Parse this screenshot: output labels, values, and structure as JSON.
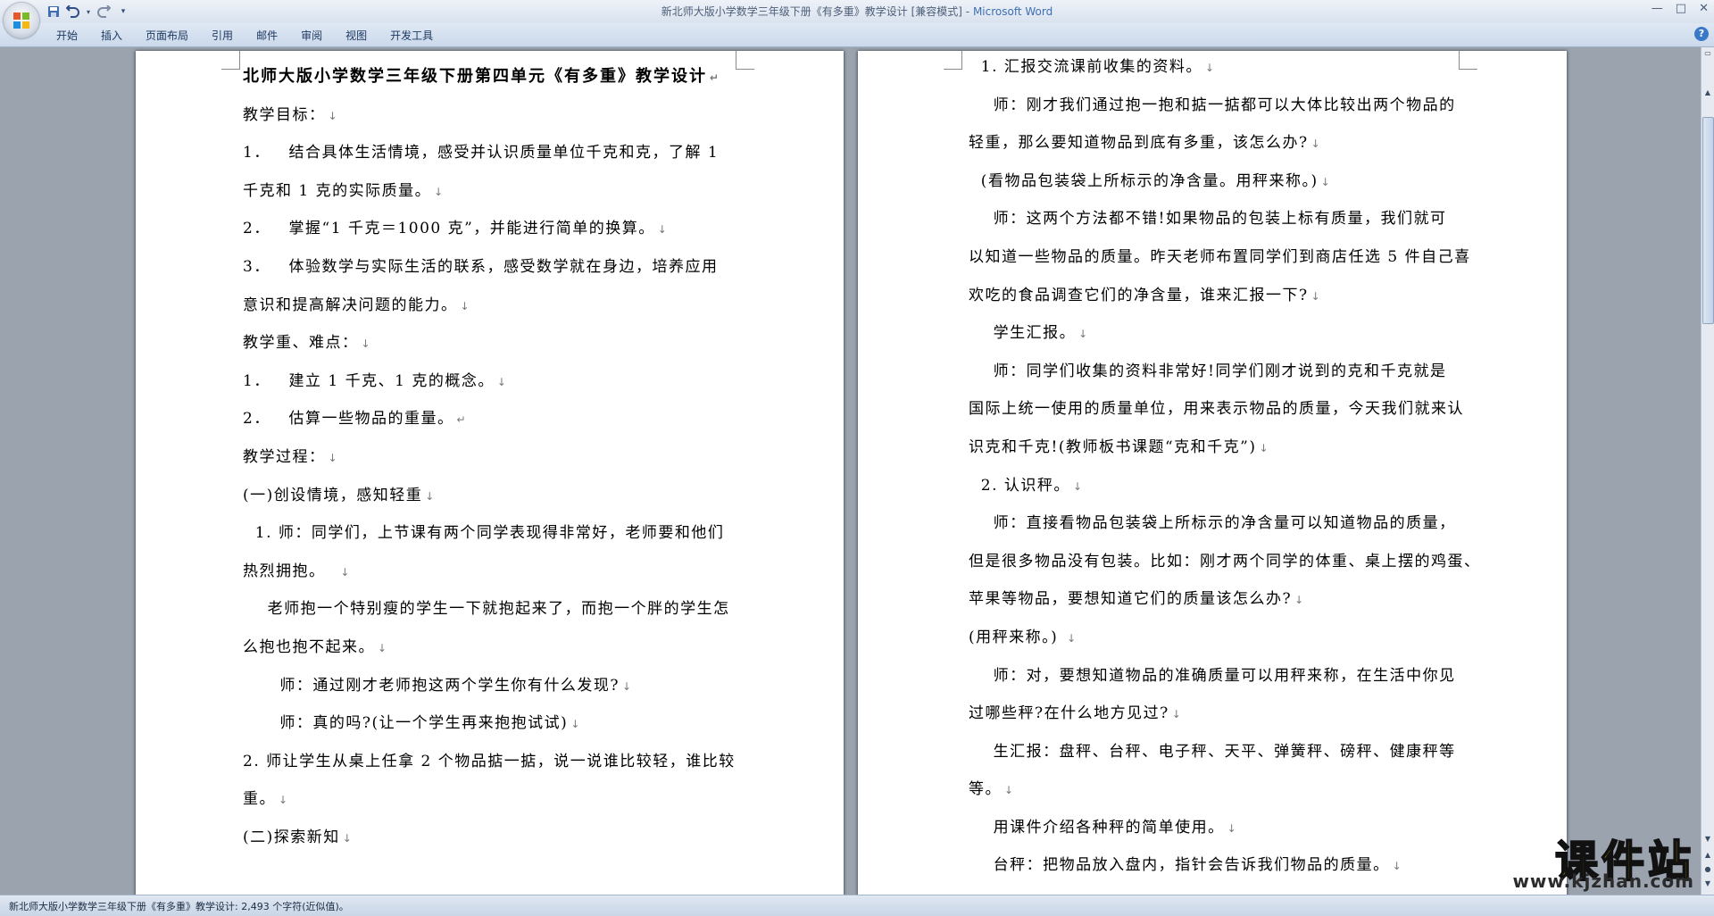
{
  "window": {
    "title_doc": "新北师大版小学数学三年级下册《有多重》教学设计 [兼容模式]",
    "title_sep": " - ",
    "title_app": "Microsoft Word",
    "minimize": "—",
    "maximize": "□",
    "close": "✕"
  },
  "quick_access": {
    "save_icon": "save-icon",
    "undo_icon": "undo-icon",
    "redo_icon": "redo-icon",
    "customize_icon": "dropdown-icon"
  },
  "ribbon": {
    "tabs": [
      "开始",
      "插入",
      "页面布局",
      "引用",
      "邮件",
      "审阅",
      "视图",
      "开发工具"
    ],
    "help": "?"
  },
  "document": {
    "left_page": [
      {
        "text": "北师大版小学数学三年级下册第四单元《有多重》教学设计",
        "mark": "↵"
      },
      {
        "text": "教学目标：",
        "mark": "↓"
      },
      {
        "text": "1．   结合具体生活情境，感受并认识质量单位千克和克，了解 1",
        "mark": ""
      },
      {
        "text": "千克和 1 克的实际质量。",
        "mark": "↓"
      },
      {
        "text": "2．   掌握“1 千克＝1000 克”，并能进行简单的换算。",
        "mark": "↓"
      },
      {
        "text": "3．   体验数学与实际生活的联系，感受数学就在身边，培养应用",
        "mark": ""
      },
      {
        "text": "意识和提高解决问题的能力。",
        "mark": "↓"
      },
      {
        "text": "教学重、难点：",
        "mark": "↓"
      },
      {
        "text": "1．   建立 1 千克、1 克的概念。",
        "mark": "↓"
      },
      {
        "text": "2．   估算一些物品的重量。",
        "mark": "↵"
      },
      {
        "text": "教学过程：",
        "mark": "↓"
      },
      {
        "text": "(一)创设情境，感知轻重",
        "mark": "↓"
      },
      {
        "text": "  1. 师：同学们，上节课有两个同学表现得非常好，老师要和他们",
        "mark": ""
      },
      {
        "text": "热烈拥抱。  ",
        "mark": "↓"
      },
      {
        "text": "    老师抱一个特别瘦的学生一下就抱起来了，而抱一个胖的学生怎",
        "mark": ""
      },
      {
        "text": "么抱也抱不起来。",
        "mark": "↓"
      },
      {
        "text": "      师：通过刚才老师抱这两个学生你有什么发现?",
        "mark": "↓"
      },
      {
        "text": "      师：真的吗?(让一个学生再来抱抱试试)",
        "mark": "↓"
      },
      {
        "text": "2. 师让学生从桌上任拿 2 个物品掂一掂，说一说谁比较轻，谁比较",
        "mark": ""
      },
      {
        "text": "重。",
        "mark": "↓"
      },
      {
        "text": "(二)探索新知",
        "mark": "↓"
      }
    ],
    "right_page": [
      {
        "text": "  1. 汇报交流课前收集的资料。",
        "mark": "↓"
      },
      {
        "text": "    师：刚才我们通过抱一抱和掂一掂都可以大体比较出两个物品的",
        "mark": ""
      },
      {
        "text": "轻重，那么要知道物品到底有多重，该怎么办?",
        "mark": "↓"
      },
      {
        "text": "  (看物品包装袋上所标示的净含量。用秤来称。)",
        "mark": "↓"
      },
      {
        "text": "    师：这两个方法都不错!如果物品的包装上标有质量，我们就可",
        "mark": ""
      },
      {
        "text": "以知道一些物品的质量。昨天老师布置同学们到商店任选 5 件自己喜",
        "mark": ""
      },
      {
        "text": "欢吃的食品调查它们的净含量，谁来汇报一下?",
        "mark": "↓"
      },
      {
        "text": "    学生汇报。",
        "mark": "↓"
      },
      {
        "text": "    师：同学们收集的资料非常好!同学们刚才说到的克和千克就是",
        "mark": ""
      },
      {
        "text": "国际上统一使用的质量单位，用来表示物品的质量，今天我们就来认",
        "mark": ""
      },
      {
        "text": "识克和千克!(教师板书课题“克和千克”)",
        "mark": "↓"
      },
      {
        "text": "  2. 认识秤。",
        "mark": "↓"
      },
      {
        "text": "    师：直接看物品包装袋上所标示的净含量可以知道物品的质量，",
        "mark": ""
      },
      {
        "text": "但是很多物品没有包装。比如：刚才两个同学的体重、桌上摆的鸡蛋、",
        "mark": ""
      },
      {
        "text": "苹果等物品，要想知道它们的质量该怎么办?",
        "mark": "↓"
      },
      {
        "text": "(用秤来称。) ",
        "mark": "↓"
      },
      {
        "text": "    师：对，要想知道物品的准确质量可以用秤来称，在生活中你见",
        "mark": ""
      },
      {
        "text": "过哪些秤?在什么地方见过?",
        "mark": "↓"
      },
      {
        "text": "    生汇报：盘秤、台秤、电子秤、天平、弹簧秤、磅秤、健康秤等",
        "mark": ""
      },
      {
        "text": "等。",
        "mark": "↓"
      },
      {
        "text": "    用课件介绍各种秤的简单使用。",
        "mark": "↓"
      },
      {
        "text": "    台秤：把物品放入盘内，指针会告诉我们物品的质量。",
        "mark": "↓"
      }
    ]
  },
  "status_bar": {
    "text": "新北师大版小学数学三年级下册《有多重》教学设计: 2,493 个字符(近似值)。"
  },
  "watermark": {
    "main": "课件站",
    "url": "www.kjzhan.com"
  }
}
